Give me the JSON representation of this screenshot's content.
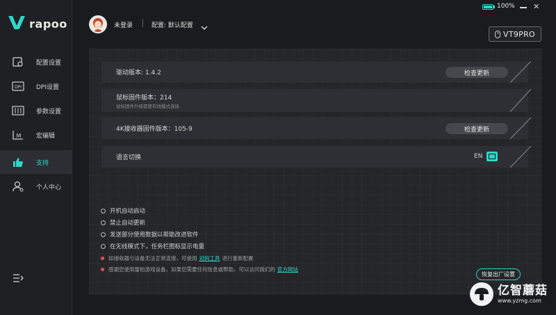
{
  "brand": {
    "logo_mark": "V",
    "name": "rapoo"
  },
  "sidebar": {
    "items": [
      {
        "label": "配置设置",
        "icon": "mouse-settings-icon"
      },
      {
        "label": "DPI设置",
        "icon": "dpi-icon"
      },
      {
        "label": "参数设置",
        "icon": "sliders-icon"
      },
      {
        "label": "宏编辑",
        "icon": "macro-icon"
      },
      {
        "label": "支持",
        "icon": "thumbs-up-icon",
        "active": true
      },
      {
        "label": "个人中心",
        "icon": "user-icon"
      }
    ],
    "collapse_icon": "collapse-menu-icon"
  },
  "header": {
    "login_status": "未登录",
    "config_label": "配置: 默认配置",
    "battery": "100%",
    "device": "VT9PRO"
  },
  "support": {
    "rows": [
      {
        "label": "驱动版本: 1.4.2",
        "button": "检查更新"
      },
      {
        "label": "鼠标固件版本：214",
        "sub": "鼠标固件升级需要有线模式连接"
      },
      {
        "label": "4K接收器固件版本：105-9",
        "button": "检查更新"
      },
      {
        "label": "语言切换",
        "lang_en": "EN"
      }
    ],
    "options": [
      "开机自动启动",
      "禁止自动更新",
      "发送部分使用数据以帮助改进软件",
      "在无线模式下，任务栏图标显示电量"
    ],
    "notes": [
      {
        "before": "如接收器与设备无法正常连接，可使用",
        "link": "对码工具",
        "after": "进行重新配置"
      },
      {
        "before": "感谢您使用雷柏游戏设备。如果您需要任何信息或帮助，可以访问我们的",
        "link": "官方网站",
        "after": ""
      }
    ],
    "factory_reset": "恢复出厂设置"
  },
  "watermark": {
    "title": "亿智蘑菇",
    "url": "www.yzmg.com"
  },
  "colors": {
    "accent": "#2fd6c8",
    "bg": "#1a1b1e",
    "panel": "#25262a",
    "row": "#2e2f34",
    "note_dot": "#e05461"
  }
}
